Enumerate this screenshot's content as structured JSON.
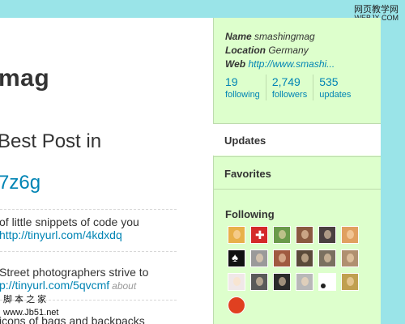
{
  "watermark_top": {
    "line1": "网页教学网",
    "line2": "WEBJX.COM"
  },
  "watermark_bottom": {
    "line1": "脚 本 之 家",
    "line2": "www.Jb51.net"
  },
  "main": {
    "name_partial": "mag",
    "status_partial": "Best Post in",
    "status_link_partial": "7z6g",
    "tweets": [
      {
        "text": "of little snippets of code you",
        "link": "http://tinyurl.com/4kdxdq",
        "meta": ""
      },
      {
        "text": " Street photographers strive to",
        "link": "p://tinyurl.com/5qvcmf",
        "meta": "about"
      },
      {
        "text": "icons of bags and backpacks",
        "link": "",
        "meta": ""
      }
    ]
  },
  "profile": {
    "name_label": "Name",
    "name_value": "smashingmag",
    "location_label": "Location",
    "location_value": "Germany",
    "web_label": "Web",
    "web_value": "http://www.smashi..."
  },
  "stats": [
    {
      "num": "19",
      "label": "following"
    },
    {
      "num": "2,749",
      "label": "followers"
    },
    {
      "num": "535",
      "label": "updates"
    }
  ],
  "tabs": {
    "updates": "Updates",
    "favorites": "Favorites"
  },
  "following": {
    "title": "Following",
    "avatars": [
      {
        "name": "cartoon-face",
        "color": "#e8b04a"
      },
      {
        "name": "swiss-flag",
        "color": "#d42a2a"
      },
      {
        "name": "santa",
        "color": "#6a9a4a"
      },
      {
        "name": "man-portrait",
        "color": "#8a5a40"
      },
      {
        "name": "man-dark",
        "color": "#4a4040"
      },
      {
        "name": "cartoon-orange",
        "color": "#e0a060"
      },
      {
        "name": "spade",
        "color": "#111111"
      },
      {
        "name": "bald-man",
        "color": "#9a9a9a"
      },
      {
        "name": "man-red",
        "color": "#a05a40"
      },
      {
        "name": "woman-dark",
        "color": "#5a4a3a"
      },
      {
        "name": "man-grey",
        "color": "#7a7060"
      },
      {
        "name": "man-glasses",
        "color": "#b09070"
      },
      {
        "name": "andi-logo",
        "color": "#f0e8e8"
      },
      {
        "name": "man-bw",
        "color": "#5a5a5a"
      },
      {
        "name": "man-black",
        "color": "#2a2a2a"
      },
      {
        "name": "man-smile",
        "color": "#b8b8b8"
      },
      {
        "name": "dot-black",
        "color": "#222222"
      },
      {
        "name": "man-yellow",
        "color": "#c0a050"
      },
      {
        "name": "red-logo",
        "color": "#e04020"
      }
    ]
  }
}
